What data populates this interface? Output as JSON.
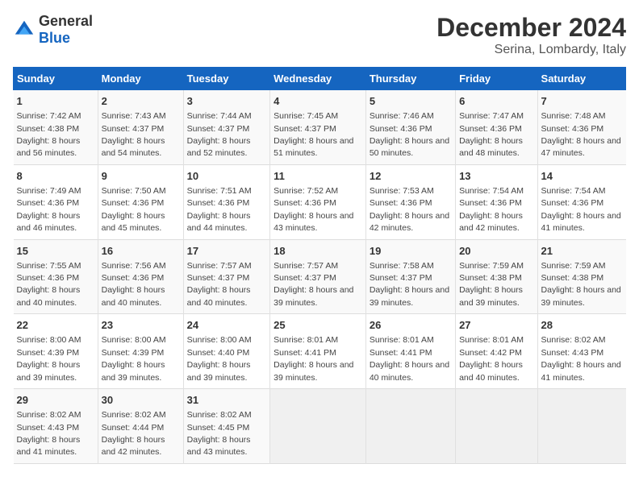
{
  "header": {
    "logo": {
      "general": "General",
      "blue": "Blue"
    },
    "title": "December 2024",
    "subtitle": "Serina, Lombardy, Italy"
  },
  "calendar": {
    "weekdays": [
      "Sunday",
      "Monday",
      "Tuesday",
      "Wednesday",
      "Thursday",
      "Friday",
      "Saturday"
    ],
    "weeks": [
      [
        {
          "day": 1,
          "sunrise": "7:42 AM",
          "sunset": "4:38 PM",
          "daylight": "8 hours and 56 minutes."
        },
        {
          "day": 2,
          "sunrise": "7:43 AM",
          "sunset": "4:37 PM",
          "daylight": "8 hours and 54 minutes."
        },
        {
          "day": 3,
          "sunrise": "7:44 AM",
          "sunset": "4:37 PM",
          "daylight": "8 hours and 52 minutes."
        },
        {
          "day": 4,
          "sunrise": "7:45 AM",
          "sunset": "4:37 PM",
          "daylight": "8 hours and 51 minutes."
        },
        {
          "day": 5,
          "sunrise": "7:46 AM",
          "sunset": "4:36 PM",
          "daylight": "8 hours and 50 minutes."
        },
        {
          "day": 6,
          "sunrise": "7:47 AM",
          "sunset": "4:36 PM",
          "daylight": "8 hours and 48 minutes."
        },
        {
          "day": 7,
          "sunrise": "7:48 AM",
          "sunset": "4:36 PM",
          "daylight": "8 hours and 47 minutes."
        }
      ],
      [
        {
          "day": 8,
          "sunrise": "7:49 AM",
          "sunset": "4:36 PM",
          "daylight": "8 hours and 46 minutes."
        },
        {
          "day": 9,
          "sunrise": "7:50 AM",
          "sunset": "4:36 PM",
          "daylight": "8 hours and 45 minutes."
        },
        {
          "day": 10,
          "sunrise": "7:51 AM",
          "sunset": "4:36 PM",
          "daylight": "8 hours and 44 minutes."
        },
        {
          "day": 11,
          "sunrise": "7:52 AM",
          "sunset": "4:36 PM",
          "daylight": "8 hours and 43 minutes."
        },
        {
          "day": 12,
          "sunrise": "7:53 AM",
          "sunset": "4:36 PM",
          "daylight": "8 hours and 42 minutes."
        },
        {
          "day": 13,
          "sunrise": "7:54 AM",
          "sunset": "4:36 PM",
          "daylight": "8 hours and 42 minutes."
        },
        {
          "day": 14,
          "sunrise": "7:54 AM",
          "sunset": "4:36 PM",
          "daylight": "8 hours and 41 minutes."
        }
      ],
      [
        {
          "day": 15,
          "sunrise": "7:55 AM",
          "sunset": "4:36 PM",
          "daylight": "8 hours and 40 minutes."
        },
        {
          "day": 16,
          "sunrise": "7:56 AM",
          "sunset": "4:36 PM",
          "daylight": "8 hours and 40 minutes."
        },
        {
          "day": 17,
          "sunrise": "7:57 AM",
          "sunset": "4:37 PM",
          "daylight": "8 hours and 40 minutes."
        },
        {
          "day": 18,
          "sunrise": "7:57 AM",
          "sunset": "4:37 PM",
          "daylight": "8 hours and 39 minutes."
        },
        {
          "day": 19,
          "sunrise": "7:58 AM",
          "sunset": "4:37 PM",
          "daylight": "8 hours and 39 minutes."
        },
        {
          "day": 20,
          "sunrise": "7:59 AM",
          "sunset": "4:38 PM",
          "daylight": "8 hours and 39 minutes."
        },
        {
          "day": 21,
          "sunrise": "7:59 AM",
          "sunset": "4:38 PM",
          "daylight": "8 hours and 39 minutes."
        }
      ],
      [
        {
          "day": 22,
          "sunrise": "8:00 AM",
          "sunset": "4:39 PM",
          "daylight": "8 hours and 39 minutes."
        },
        {
          "day": 23,
          "sunrise": "8:00 AM",
          "sunset": "4:39 PM",
          "daylight": "8 hours and 39 minutes."
        },
        {
          "day": 24,
          "sunrise": "8:00 AM",
          "sunset": "4:40 PM",
          "daylight": "8 hours and 39 minutes."
        },
        {
          "day": 25,
          "sunrise": "8:01 AM",
          "sunset": "4:41 PM",
          "daylight": "8 hours and 39 minutes."
        },
        {
          "day": 26,
          "sunrise": "8:01 AM",
          "sunset": "4:41 PM",
          "daylight": "8 hours and 40 minutes."
        },
        {
          "day": 27,
          "sunrise": "8:01 AM",
          "sunset": "4:42 PM",
          "daylight": "8 hours and 40 minutes."
        },
        {
          "day": 28,
          "sunrise": "8:02 AM",
          "sunset": "4:43 PM",
          "daylight": "8 hours and 41 minutes."
        }
      ],
      [
        {
          "day": 29,
          "sunrise": "8:02 AM",
          "sunset": "4:43 PM",
          "daylight": "8 hours and 41 minutes."
        },
        {
          "day": 30,
          "sunrise": "8:02 AM",
          "sunset": "4:44 PM",
          "daylight": "8 hours and 42 minutes."
        },
        {
          "day": 31,
          "sunrise": "8:02 AM",
          "sunset": "4:45 PM",
          "daylight": "8 hours and 43 minutes."
        },
        null,
        null,
        null,
        null
      ]
    ]
  }
}
